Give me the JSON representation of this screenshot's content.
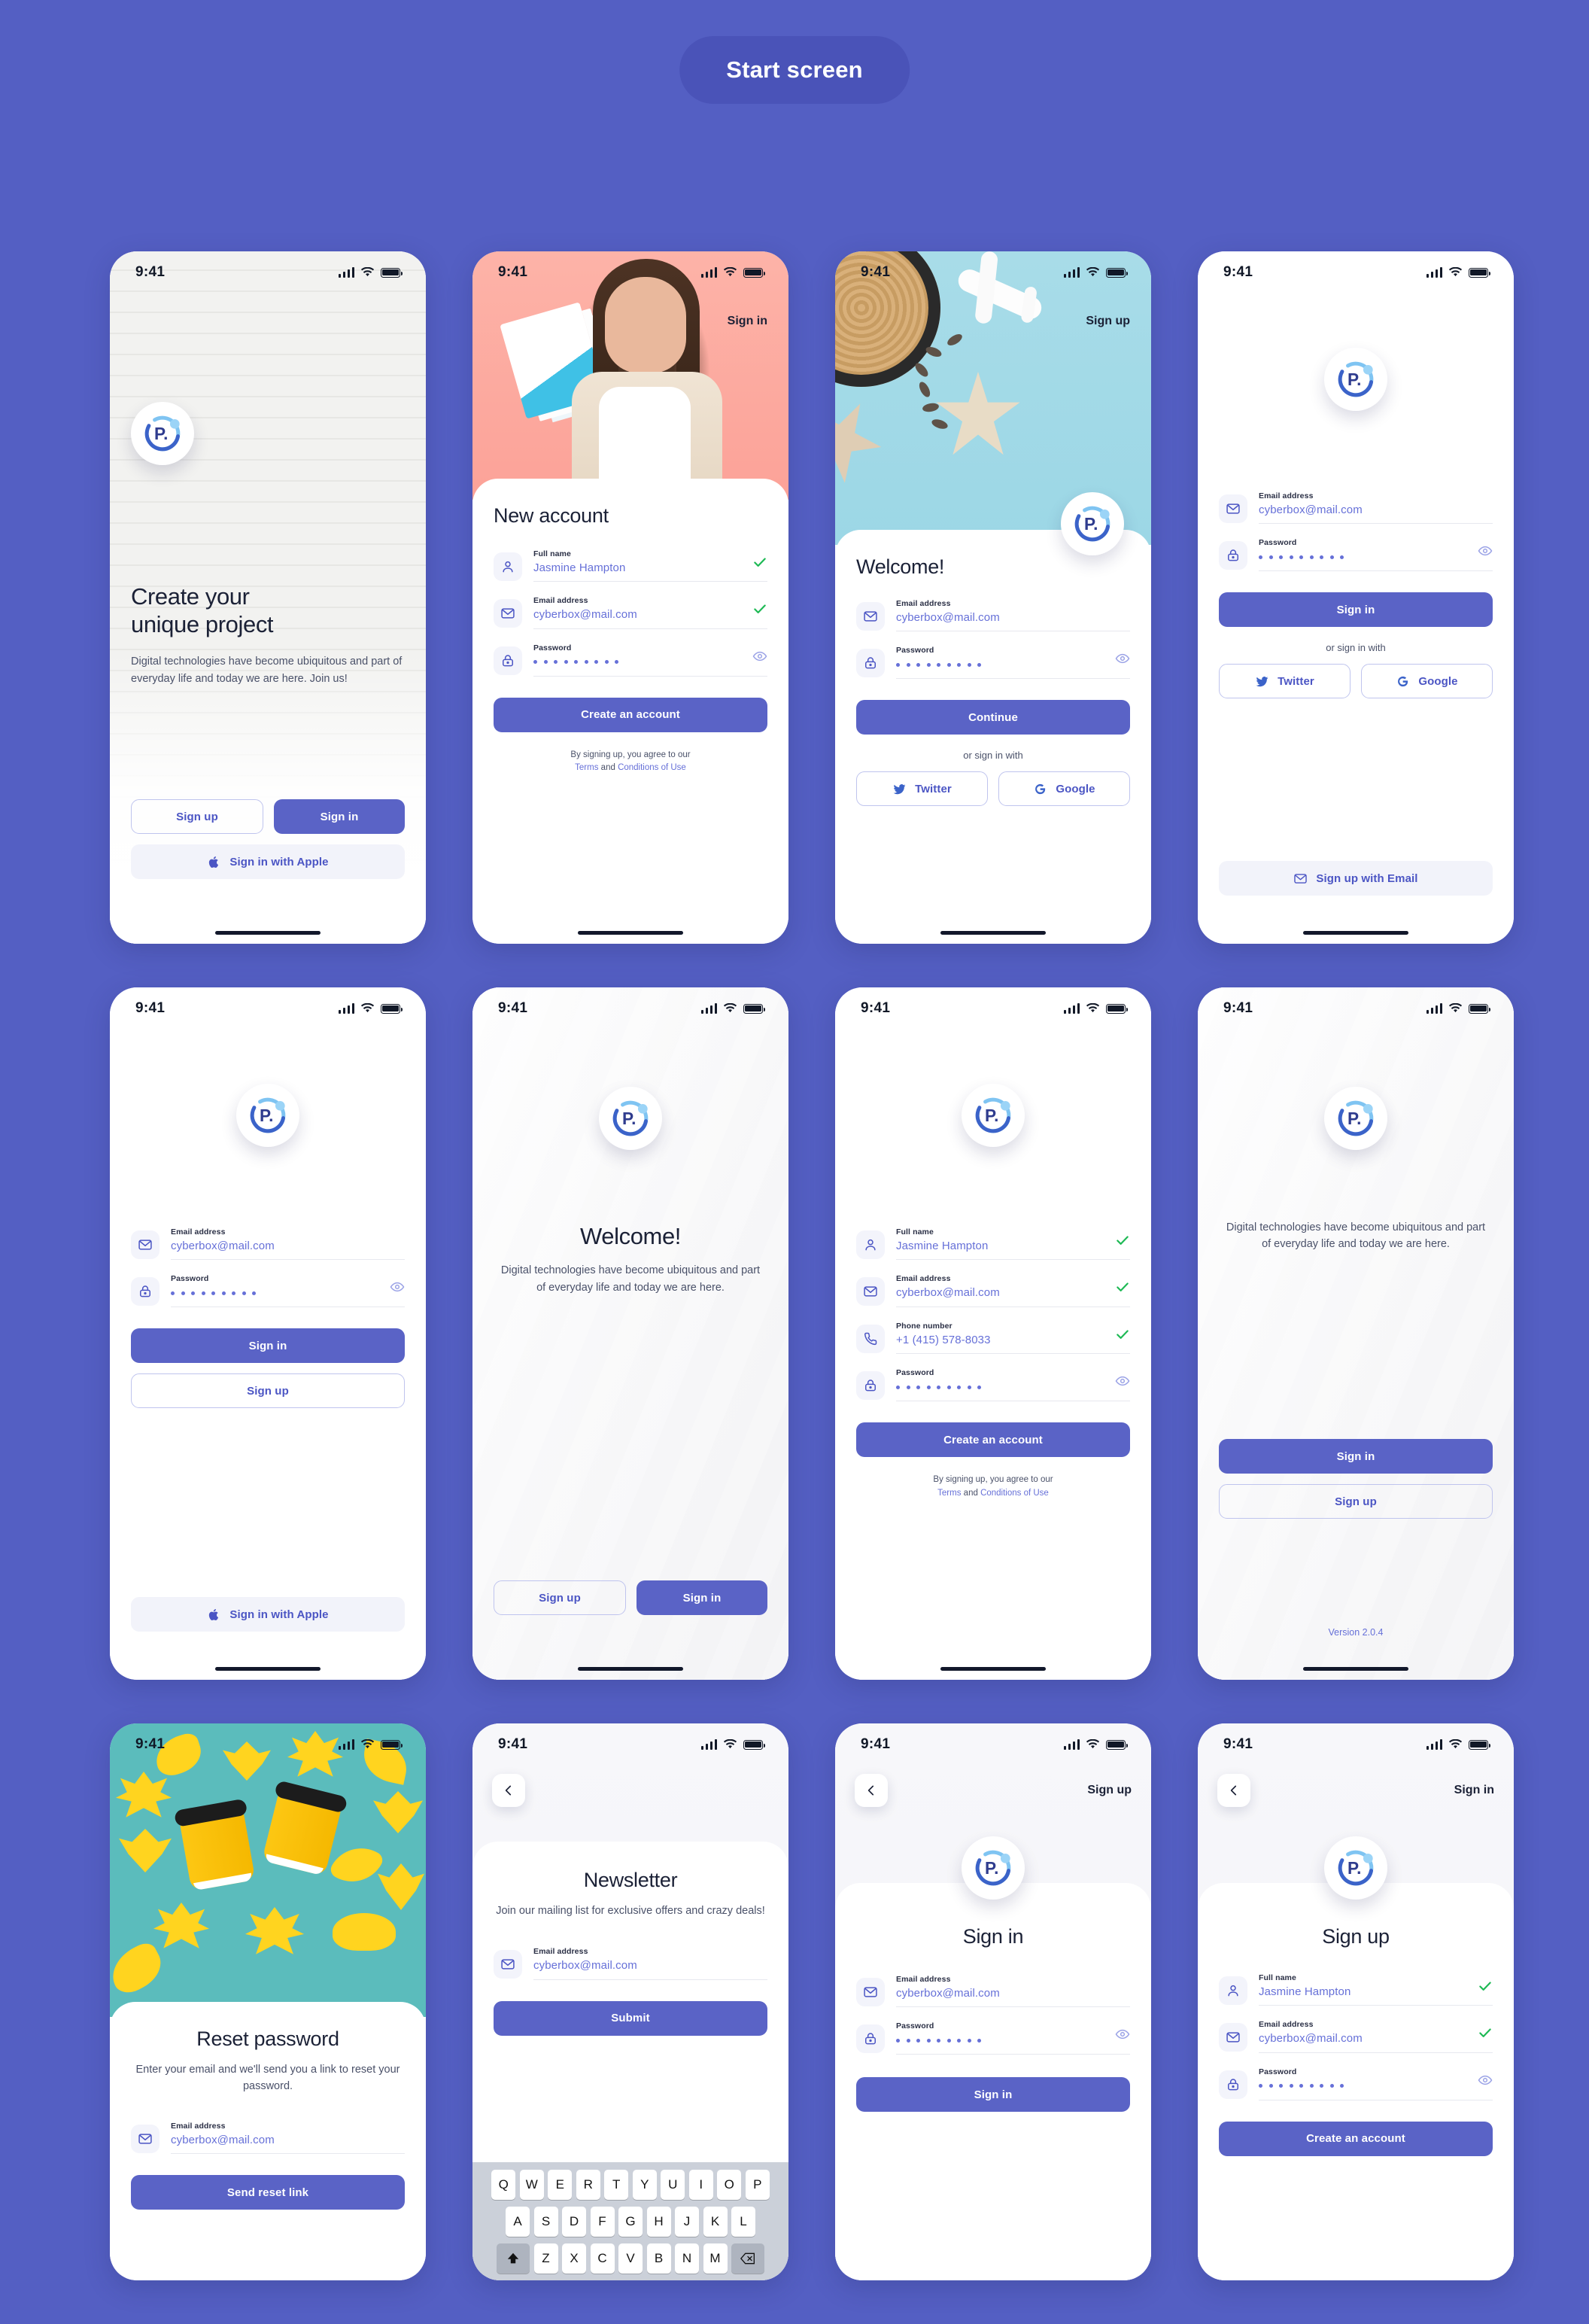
{
  "header": {
    "pill_label": "Start screen"
  },
  "status_bar": {
    "time": "9:41",
    "signal_icon": "cellular-bars-icon",
    "wifi_icon": "wifi-icon",
    "battery_icon": "battery-icon"
  },
  "brand": {
    "logo_icon": "p-circle-logo",
    "logo_letter": "P."
  },
  "common": {
    "labels": {
      "full_name": "Full name",
      "email": "Email address",
      "password": "Password",
      "phone": "Phone number"
    },
    "values": {
      "full_name": "Jasmine Hampton",
      "email": "cyberbox@mail.com",
      "phone": "+1 (415) 578-8033",
      "password_dots": 9
    },
    "or_sign_in_with": "or sign in with",
    "legal_prefix": "By signing up, you agree to our",
    "legal_terms": "Terms",
    "legal_and": "and",
    "legal_conditions": "Conditions of Use",
    "icons": {
      "user": "user-icon",
      "mail": "mail-icon",
      "lock": "lock-icon",
      "phone": "phone-icon",
      "eye": "eye-icon",
      "check": "check-icon",
      "apple": "apple-icon",
      "twitter": "twitter-icon",
      "google": "google-icon",
      "back": "chevron-left-icon"
    }
  },
  "screens": [
    {
      "id": "onboarding-brick",
      "title": "Create your\nunique project",
      "body": "Digital technologies have become ubiquitous and part of everyday life and today we are here. Join us!",
      "buttons": {
        "signup": "Sign up",
        "signin": "Sign in",
        "apple": "Sign in with Apple"
      }
    },
    {
      "id": "new-account",
      "nav_right": "Sign in",
      "title": "New account",
      "submit": "Create an account"
    },
    {
      "id": "welcome-travel",
      "nav_right": "Sign up",
      "title": "Welcome!",
      "submit": "Continue",
      "social": {
        "twitter": "Twitter",
        "google": "Google"
      }
    },
    {
      "id": "signin-social",
      "submit": "Sign in",
      "social": {
        "twitter": "Twitter",
        "google": "Google"
      },
      "email_signup": "Sign up with Email"
    },
    {
      "id": "signin-apple",
      "submit": "Sign in",
      "secondary": "Sign up",
      "apple": "Sign in with Apple"
    },
    {
      "id": "welcome-wave",
      "title": "Welcome!",
      "body": "Digital technologies have become ubiquitous and part of everyday life and today we are here.",
      "buttons": {
        "signup": "Sign up",
        "signin": "Sign in"
      }
    },
    {
      "id": "signup-full",
      "submit": "Create an account"
    },
    {
      "id": "welcome-version",
      "body": "Digital technologies have become ubiquitous and part of everyday life and today we are here.",
      "buttons": {
        "signin": "Sign in",
        "signup": "Sign up"
      },
      "version": "Version 2.0.4"
    },
    {
      "id": "reset-password",
      "title": "Reset password",
      "body": "Enter your email and we'll send you a link to reset your password.",
      "submit": "Send reset link"
    },
    {
      "id": "newsletter",
      "title": "Newsletter",
      "body": "Join our mailing list for exclusive offers and crazy deals!",
      "submit": "Submit",
      "keyboard": {
        "row1": [
          "Q",
          "W",
          "E",
          "R",
          "T",
          "Y",
          "U",
          "I",
          "O",
          "P"
        ],
        "row2": [
          "A",
          "S",
          "D",
          "F",
          "G",
          "H",
          "J",
          "K",
          "L"
        ],
        "row3": [
          "Z",
          "X",
          "C",
          "V",
          "B",
          "N",
          "M"
        ],
        "shift_icon": "shift-icon",
        "backspace_icon": "backspace-icon"
      }
    },
    {
      "id": "signin-page",
      "nav_right": "Sign up",
      "title": "Sign in",
      "submit": "Sign in"
    },
    {
      "id": "signup-page",
      "nav_right": "Sign in",
      "title": "Sign up",
      "submit": "Create an account"
    }
  ],
  "colors": {
    "background": "#545FC3",
    "primary": "#5A63C6",
    "accent_text": "#6670D8",
    "heading": "#1B2136",
    "field_bg": "#F3F4FB",
    "check_green": "#1DB954"
  }
}
